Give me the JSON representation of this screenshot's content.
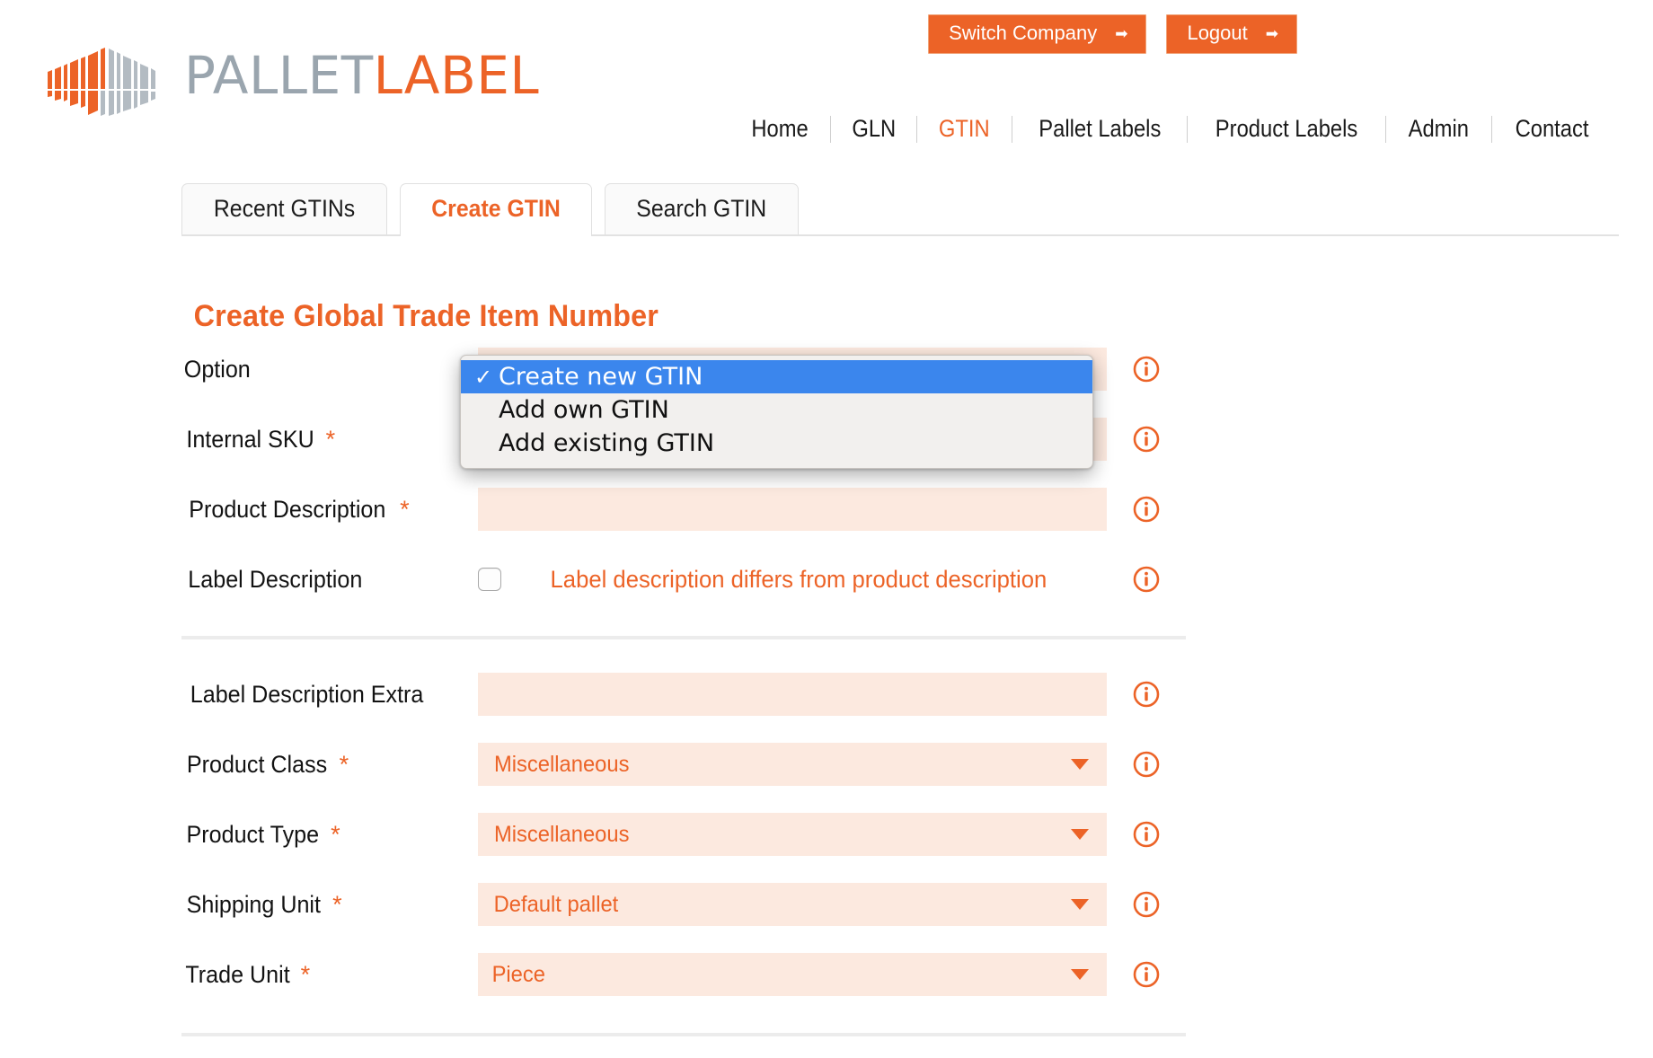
{
  "brand": {
    "logo_icon": "pallet-barcode-icon",
    "name_part1": "PALLET",
    "name_part2": "LABEL",
    "accent_color": "#EC6327",
    "muted_color": "#9AA5AE"
  },
  "topbar": {
    "switch_company_label": "Switch Company",
    "logout_label": "Logout",
    "arrow_glyph": "➡"
  },
  "mainnav": {
    "items": [
      {
        "label": "Home",
        "active": false
      },
      {
        "label": "GLN",
        "active": false
      },
      {
        "label": "GTIN",
        "active": true
      },
      {
        "label": "Pallet Labels",
        "active": false
      },
      {
        "label": "Product Labels",
        "active": false
      },
      {
        "label": "Admin",
        "active": false
      },
      {
        "label": "Contact",
        "active": false
      }
    ]
  },
  "tabs": [
    {
      "label": "Recent GTINs",
      "active": false
    },
    {
      "label": "Create GTIN",
      "active": true
    },
    {
      "label": "Search GTIN",
      "active": false
    }
  ],
  "page_title": "Create Global Trade Item Number",
  "form": {
    "required_marker": "*",
    "info_icon": "info-circle-icon",
    "rows": [
      {
        "label": "Option",
        "required": false,
        "type": "select",
        "value": "Create new GTIN"
      },
      {
        "label": "Internal SKU",
        "required": true,
        "type": "text",
        "value": ""
      },
      {
        "label": "Product Description",
        "required": true,
        "type": "text",
        "value": ""
      },
      {
        "label": "Label Description",
        "required": false,
        "type": "checkbox",
        "checkbox_label": "Label description differs from product description",
        "checked": false
      },
      {
        "label": "Label Description Extra",
        "required": false,
        "type": "text",
        "value": ""
      },
      {
        "label": "Product Class",
        "required": true,
        "type": "select",
        "value": "Miscellaneous"
      },
      {
        "label": "Product Type",
        "required": true,
        "type": "select",
        "value": "Miscellaneous"
      },
      {
        "label": "Shipping Unit",
        "required": true,
        "type": "select",
        "value": "Default pallet"
      },
      {
        "label": "Trade Unit",
        "required": true,
        "type": "select",
        "value": "Piece"
      }
    ]
  },
  "option_popup": {
    "open": true,
    "check_glyph": "✓",
    "items": [
      {
        "label": "Create new GTIN",
        "selected": true
      },
      {
        "label": "Add own GTIN",
        "selected": false
      },
      {
        "label": "Add existing GTIN",
        "selected": false
      }
    ]
  }
}
